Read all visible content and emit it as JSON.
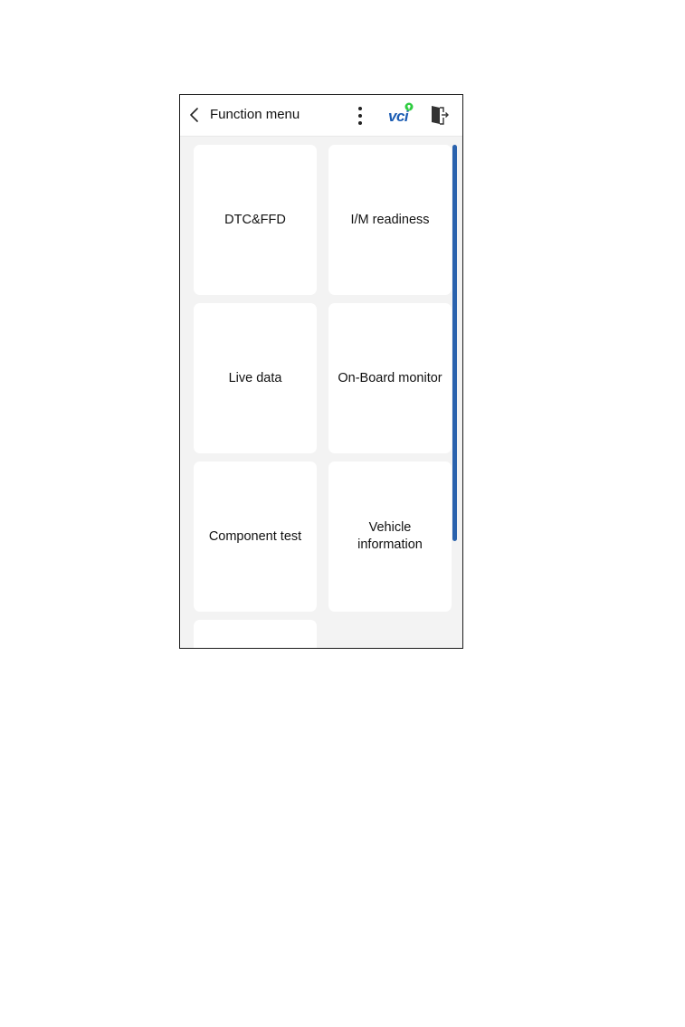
{
  "header": {
    "back_icon": "chevron-left-icon",
    "title": "Function menu",
    "more_icon": "more-vertical-icon",
    "vci_label": "vci",
    "vci_status_color": "#2ecc40",
    "exit_icon": "exit-door-icon"
  },
  "menu": {
    "items": [
      {
        "label": "DTC&FFD"
      },
      {
        "label": "I/M readiness"
      },
      {
        "label": "Live data"
      },
      {
        "label": "On-Board monitor"
      },
      {
        "label": "Component test"
      },
      {
        "label": "Vehicle\ninformation"
      },
      {
        "label": ""
      }
    ]
  },
  "colors": {
    "accent": "#1b5cb3",
    "scrollbar": "#2a62ad",
    "background": "#f3f3f3",
    "tile": "#ffffff"
  }
}
